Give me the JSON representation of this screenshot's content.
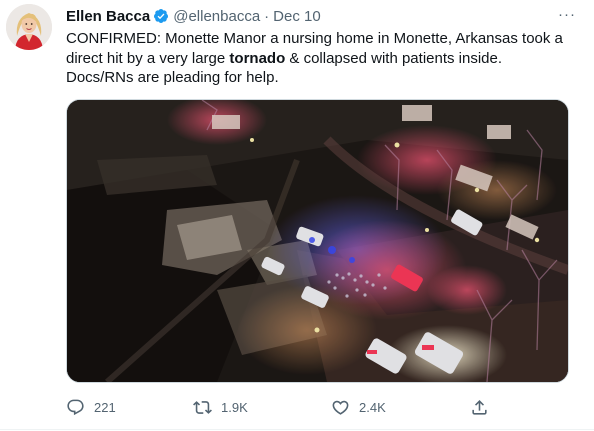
{
  "tweet": {
    "author_name": "Ellen Bacca",
    "author_handle": "@ellenbacca",
    "separator": "·",
    "date": "Dec 10",
    "more_label": "···",
    "text_before": "CONFIRMED: Monette Manor a nursing home in Monette, Arkansas took a direct hit by a very large ",
    "text_bold": "tornado",
    "text_after": " & collapsed with patients inside. Docs/RNs are pleading for help.",
    "counts": {
      "replies": "221",
      "retweets": "1.9K",
      "likes": "2.4K"
    }
  },
  "icons": {
    "verified": "verified-badge-icon",
    "more": "more-horizontal-icon",
    "reply": "reply-icon",
    "retweet": "retweet-icon",
    "like": "heart-icon",
    "share": "share-icon"
  },
  "colors": {
    "verified_blue": "#1d9bf0",
    "text_primary": "#0f1419",
    "text_secondary": "#536471",
    "border": "#cfd9de"
  }
}
